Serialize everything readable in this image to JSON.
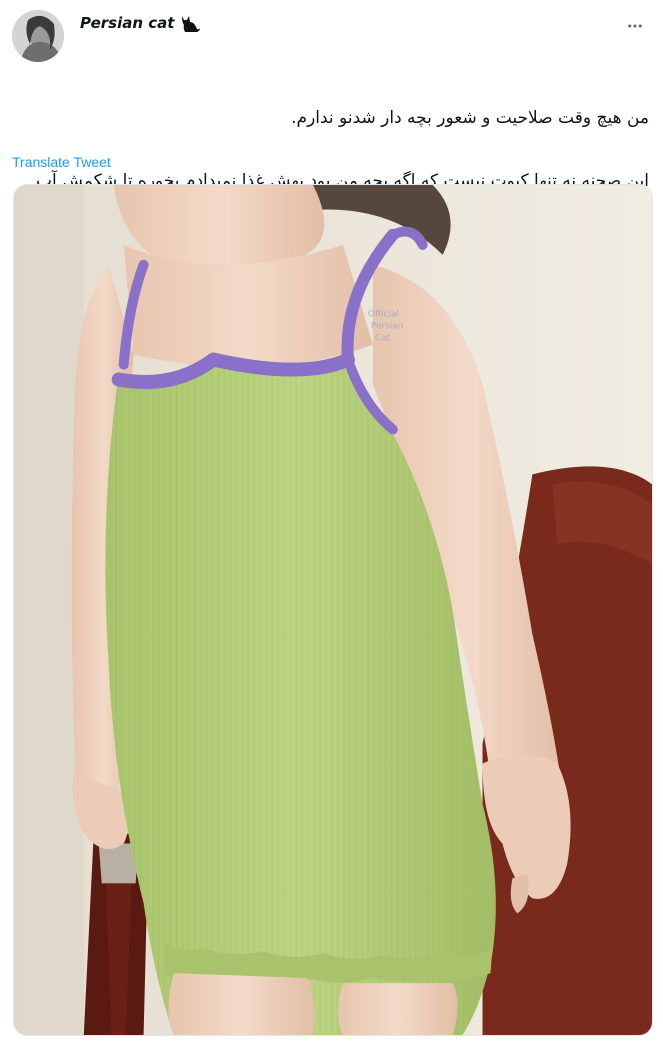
{
  "author": {
    "display_name": "Persian cat",
    "badge_icon": "black-cat-icon"
  },
  "tweet": {
    "text_line_1": "من هیچ وقت صلاحیت و شعور بچه دار شدنو ندارم.",
    "text_line_2": "این صحنه نه تنها کیوت نیست که اگه بچه من بود بهش غذا نمیدادم بخوره تا شکمش آب شه."
  },
  "actions": {
    "translate_label": "Translate Tweet",
    "more_icon": "more-horizontal-icon"
  },
  "media": {
    "watermark": "Official Persian Cat",
    "colors": {
      "dress": "#b5cf78",
      "straps": "#8a70c8",
      "skin": "#f0d3bf",
      "wall": "#ece6da",
      "chair": "#7a2a1c"
    }
  },
  "colors": {
    "link": "#1d9bf0",
    "text": "#0f1419",
    "muted": "#536471"
  }
}
